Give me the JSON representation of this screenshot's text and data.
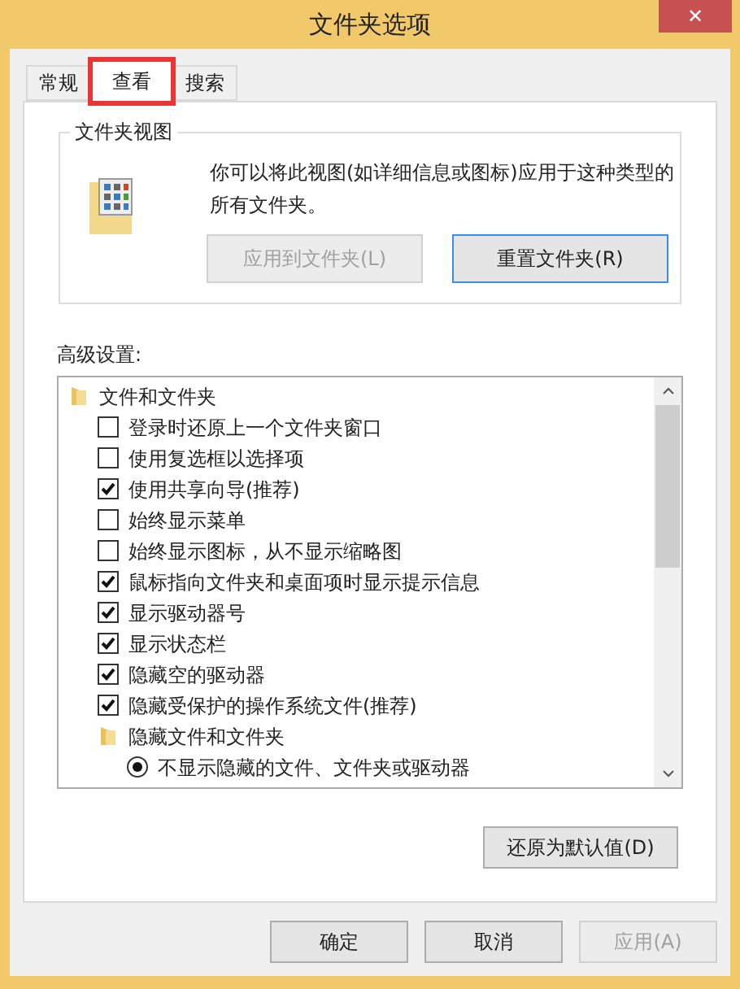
{
  "window": {
    "title": "文件夹选项",
    "close": "✕"
  },
  "tabs": [
    {
      "label": "常规",
      "selected": false,
      "highlighted": false
    },
    {
      "label": "查看",
      "selected": true,
      "highlighted": true
    },
    {
      "label": "搜索",
      "selected": false,
      "highlighted": false
    }
  ],
  "folder_views": {
    "title": "文件夹视图",
    "description": "你可以将此视图(如详细信息或图标)应用于这种类型的所有文件夹。",
    "buttons": [
      {
        "label": "应用到文件夹(L)",
        "disabled": true,
        "focused": false
      },
      {
        "label": "重置文件夹(R)",
        "disabled": false,
        "focused": true
      }
    ]
  },
  "advanced": {
    "label": "高级设置:",
    "items": [
      {
        "kind": "folder",
        "label": "文件和文件夹",
        "children": [
          {
            "kind": "checkbox",
            "label": "登录时还原上一个文件夹窗口",
            "checked": false
          },
          {
            "kind": "checkbox",
            "label": "使用复选框以选择项",
            "checked": false
          },
          {
            "kind": "checkbox",
            "label": "使用共享向导(推荐)",
            "checked": true
          },
          {
            "kind": "checkbox",
            "label": "始终显示菜单",
            "checked": false
          },
          {
            "kind": "checkbox",
            "label": "始终显示图标，从不显示缩略图",
            "checked": false
          },
          {
            "kind": "checkbox",
            "label": "鼠标指向文件夹和桌面项时显示提示信息",
            "checked": true
          },
          {
            "kind": "checkbox",
            "label": "显示驱动器号",
            "checked": true
          },
          {
            "kind": "checkbox",
            "label": "显示状态栏",
            "checked": true
          },
          {
            "kind": "checkbox",
            "label": "隐藏空的驱动器",
            "checked": true
          },
          {
            "kind": "checkbox",
            "label": "隐藏受保护的操作系统文件(推荐)",
            "checked": true
          },
          {
            "kind": "folder",
            "label": "隐藏文件和文件夹",
            "children": [
              {
                "kind": "radio",
                "label": "不显示隐藏的文件、文件夹或驱动器",
                "checked": true
              }
            ]
          }
        ]
      }
    ],
    "restore_button": "还原为默认值(D)"
  },
  "footer_buttons": [
    {
      "label": "确定",
      "disabled": false
    },
    {
      "label": "取消",
      "disabled": false
    },
    {
      "label": "应用(A)",
      "disabled": true
    }
  ]
}
